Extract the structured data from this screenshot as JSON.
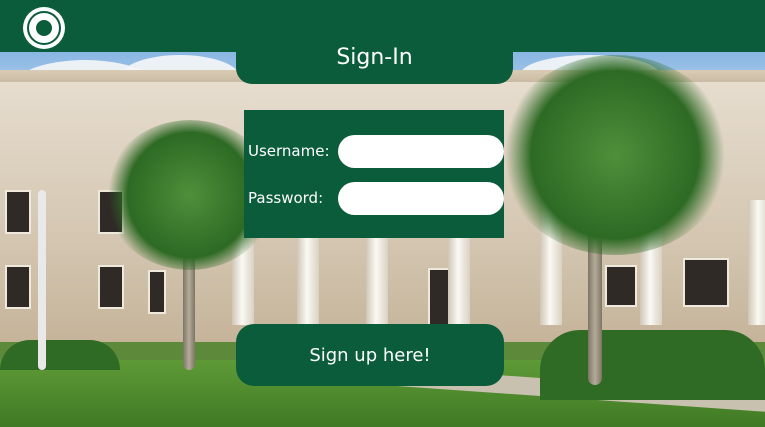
{
  "header": {
    "logo_icon": "university-seal-icon",
    "background_color": "#0b5c3a"
  },
  "page": {
    "title": "Sign-In",
    "accent_color": "#0b5c3a"
  },
  "login_form": {
    "username_label": "Username:",
    "username_value": "",
    "password_label": "Password:",
    "password_value": ""
  },
  "signup": {
    "button_label": "Sign up here!"
  }
}
